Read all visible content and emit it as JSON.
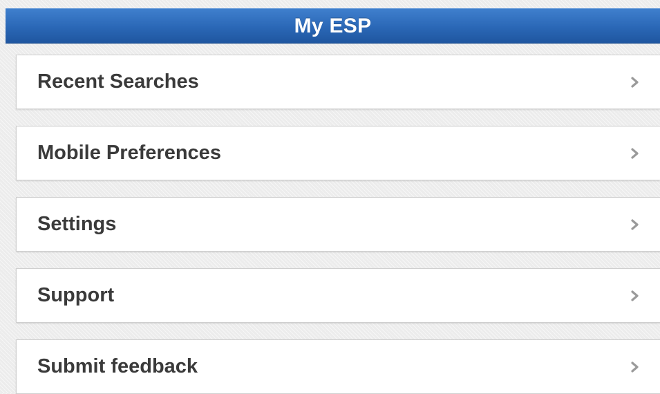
{
  "header": {
    "title": "My ESP",
    "color": "#2a67b6"
  },
  "menu": {
    "items": [
      {
        "label": "Recent Searches",
        "icon": "chevron-right-icon"
      },
      {
        "label": "Mobile Preferences",
        "icon": "chevron-right-icon"
      },
      {
        "label": "Settings",
        "icon": "chevron-right-icon"
      },
      {
        "label": "Support",
        "icon": "chevron-right-icon"
      },
      {
        "label": "Submit feedback",
        "icon": "chevron-right-icon"
      }
    ]
  }
}
